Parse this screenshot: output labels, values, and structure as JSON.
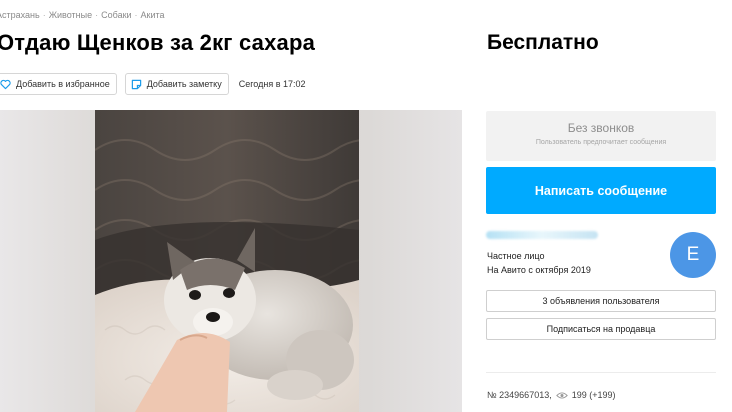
{
  "breadcrumb": [
    "Астрахань",
    "Животные",
    "Собаки",
    "Акита"
  ],
  "title": "Отдаю Щенков за 2кг сахара",
  "price": "Бесплатно",
  "actions": {
    "favorite_label": "Добавить в избранное",
    "note_label": "Добавить заметку",
    "date": "Сегодня в 17:02"
  },
  "contact": {
    "no_calls": "Без звонков",
    "no_calls_sub": "Пользователь предпочитает сообщения",
    "write_message": "Написать сообщение"
  },
  "seller": {
    "type": "Частное лицо",
    "since": "На Авито с октября 2019",
    "avatar_letter": "E",
    "ads_button": "3 объявления пользователя",
    "subscribe_button": "Подписаться на продавца"
  },
  "meta": {
    "ad_number": "№ 2349667013,",
    "views": "199 (+199)"
  },
  "colors": {
    "accent": "#00aaff",
    "avatar": "#4c96e6"
  }
}
